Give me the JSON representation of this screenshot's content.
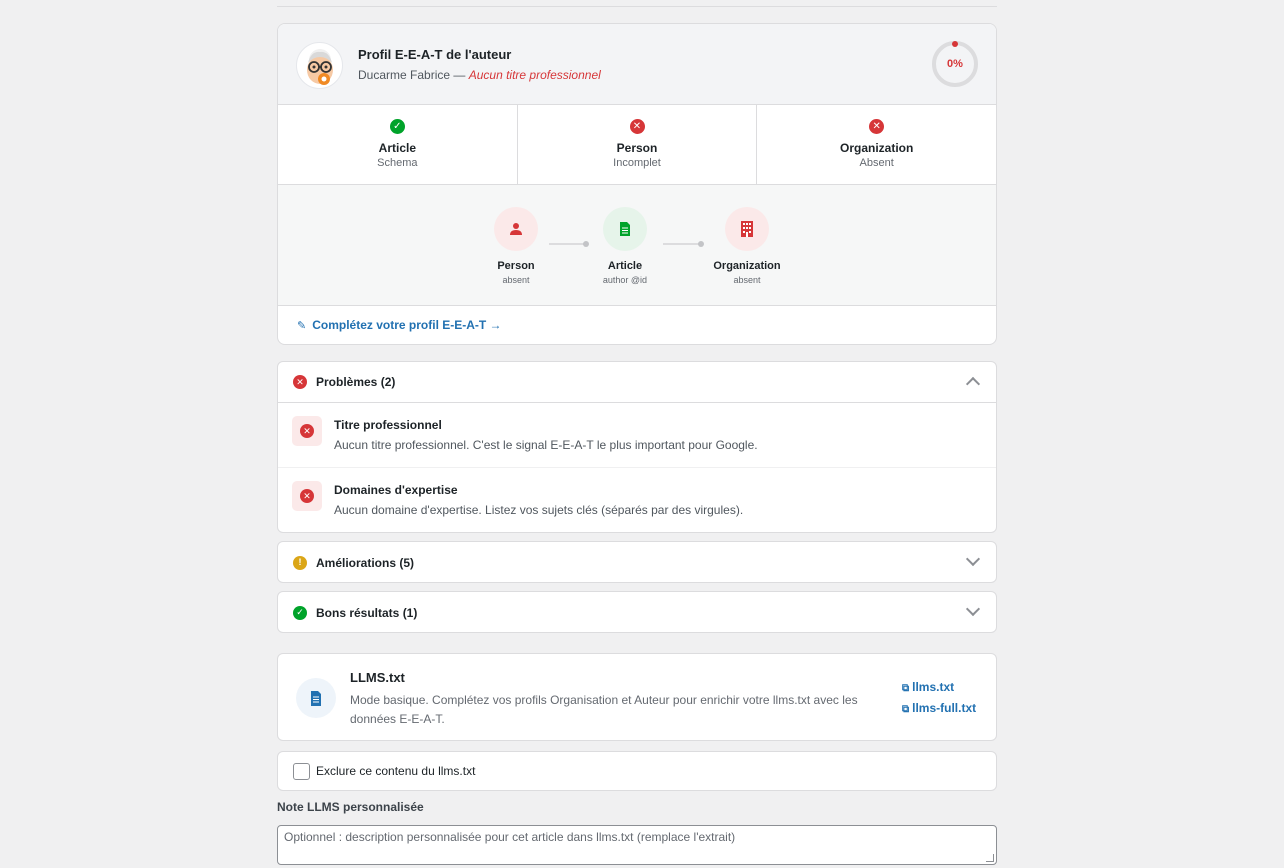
{
  "eeat": {
    "title": "Profil E-E-A-T de l'auteur",
    "author_name": "Ducarme Fabrice —",
    "author_status": "Aucun titre professionnel",
    "score": "0%",
    "schemas": [
      {
        "name": "Article",
        "status": "Schema",
        "state": "ok"
      },
      {
        "name": "Person",
        "status": "Incomplet",
        "state": "error"
      },
      {
        "name": "Organization",
        "status": "Absent",
        "state": "error"
      }
    ],
    "graph": [
      {
        "name": "Person",
        "status": "absent"
      },
      {
        "name": "Article",
        "status": "author @id"
      },
      {
        "name": "Organization",
        "status": "absent"
      }
    ],
    "complete_link": "Complétez votre profil E-E-A-T →"
  },
  "problems": {
    "title": "Problèmes (2)",
    "items": [
      {
        "title": "Titre professionnel",
        "desc": "Aucun titre professionnel. C'est le signal E-E-A-T le plus important pour Google."
      },
      {
        "title": "Domaines d'expertise",
        "desc": "Aucun domaine d'expertise. Listez vos sujets clés (séparés par des virgules)."
      }
    ]
  },
  "improvements": {
    "title": "Améliorations (5)"
  },
  "good": {
    "title": "Bons résultats (1)"
  },
  "llms": {
    "title": "LLMS.txt",
    "desc": "Mode basique. Complétez vos profils Organisation et Auteur pour enrichir votre llms.txt avec les données E-E-A-T.",
    "link1": "llms.txt",
    "link2": "llms-full.txt"
  },
  "exclude": {
    "label": "Exclure ce contenu du llms.txt",
    "checked": false
  },
  "note": {
    "label": "Note LLMS personnalisée",
    "placeholder": "Optionnel : description personnalisée pour cet article dans llms.txt (remplace l'extrait)"
  },
  "colors": {
    "error": "#d63638",
    "success": "#00a32a",
    "warning": "#dba617",
    "link": "#2271b1"
  }
}
